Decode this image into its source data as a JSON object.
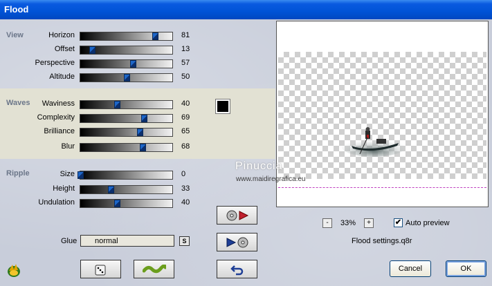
{
  "window": {
    "title": "Flood"
  },
  "groups": {
    "view": {
      "label": "View",
      "rows": [
        {
          "label": "Horizon",
          "value": "81",
          "fraction": 0.81
        },
        {
          "label": "Offset",
          "value": "13",
          "fraction": 0.13
        },
        {
          "label": "Perspective",
          "value": "57",
          "fraction": 0.57
        },
        {
          "label": "Altitude",
          "value": "50",
          "fraction": 0.5
        }
      ]
    },
    "waves": {
      "label": "Waves",
      "rows": [
        {
          "label": "Waviness",
          "value": "40",
          "fraction": 0.4
        },
        {
          "label": "Complexity",
          "value": "69",
          "fraction": 0.69
        },
        {
          "label": "Brilliance",
          "value": "65",
          "fraction": 0.65
        },
        {
          "label": "Blur",
          "value": "68",
          "fraction": 0.68
        }
      ],
      "color": "#000000"
    },
    "ripple": {
      "label": "Ripple",
      "rows": [
        {
          "label": "Size",
          "value": "0",
          "fraction": 0.0
        },
        {
          "label": "Height",
          "value": "33",
          "fraction": 0.33
        },
        {
          "label": "Undulation",
          "value": "40",
          "fraction": 0.4
        }
      ]
    }
  },
  "glue": {
    "label": "Glue",
    "value": "normal",
    "s_label": "S"
  },
  "preview": {
    "watermark_line1": "Pinuccia",
    "watermark_line2": "www.maidiregrafica.eu"
  },
  "zoom": {
    "minus": "-",
    "value": "33%",
    "plus": "+"
  },
  "auto_preview": {
    "label": "Auto preview",
    "checked": true,
    "mark": "✔"
  },
  "settings_file": "Flood settings.q8r",
  "buttons": {
    "cancel": "Cancel",
    "ok": "OK"
  },
  "icons": {
    "logo": "filters-unlimited-logo",
    "randomize": "dice-icon",
    "wave": "wave-icon",
    "save": "save-preset-icon",
    "load": "load-preset-icon",
    "reset": "undo-icon"
  }
}
